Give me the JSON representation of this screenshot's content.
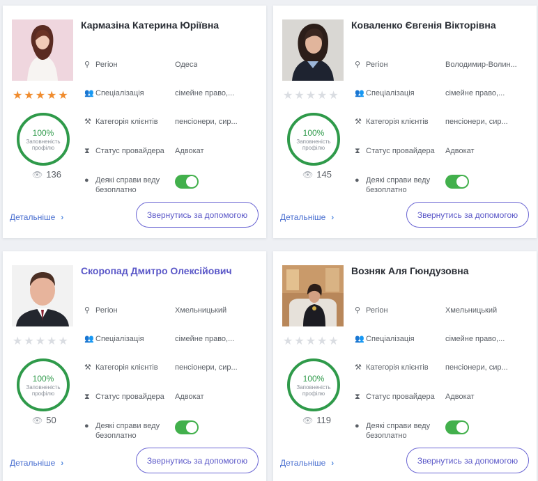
{
  "common": {
    "labels": {
      "region": "Регіон",
      "specialization": "Спеціалізація",
      "client_category": "Категорія клієнтів",
      "provider_status": "Статус провайдера",
      "pro_bono": "Деякі справи веду безоплатно"
    },
    "completeness_label": "Заповненість профілю",
    "more_link": "Детальніше",
    "help_button": "Звернутись за допомогою",
    "colors": {
      "accent": "#5b58c8",
      "star_on": "#f08c2e",
      "star_off": "#dadde2",
      "ring": "#2f9a4a",
      "toggle": "#42b04c"
    }
  },
  "providers": [
    {
      "name": "Кармазіна Катерина Юріївна",
      "rating": 5,
      "completeness": "100%",
      "completeness_fraction": 1.0,
      "views": "136",
      "region": "Одеса",
      "specialization": "сімейне право,...",
      "client_category": "пенсіонери, сир...",
      "status": "Адвокат",
      "pro_bono": true
    },
    {
      "name": "Коваленко Євгенія Вікторівна",
      "rating": 0,
      "completeness": "100%",
      "completeness_fraction": 1.0,
      "views": "145",
      "region": "Володимир-Волин...",
      "specialization": "сімейне право,...",
      "client_category": "пенсіонери, сир...",
      "status": "Адвокат",
      "pro_bono": true
    },
    {
      "name": "Скоропад Дмитро Олексійович",
      "rating": 0,
      "completeness": "100%",
      "completeness_fraction": 1.0,
      "views": "50",
      "region": "Хмельницький",
      "specialization": "сімейне право,...",
      "client_category": "пенсіонери, сир...",
      "status": "Адвокат",
      "pro_bono": true
    },
    {
      "name": "Возняк Аля Гюндузовна",
      "rating": 0,
      "completeness": "100%",
      "completeness_fraction": 1.0,
      "views": "119",
      "region": "Хмельницький",
      "specialization": "сімейне право,...",
      "client_category": "пенсіонери, сир...",
      "status": "Адвокат",
      "pro_bono": true
    }
  ],
  "icons": {
    "region": "map-pin-icon",
    "specialization": "people-icon",
    "client_category": "gavel-icon",
    "provider_status": "hourglass-icon",
    "pro_bono": "info-icon",
    "views": "eye-icon",
    "more": "chevron-right-icon"
  }
}
